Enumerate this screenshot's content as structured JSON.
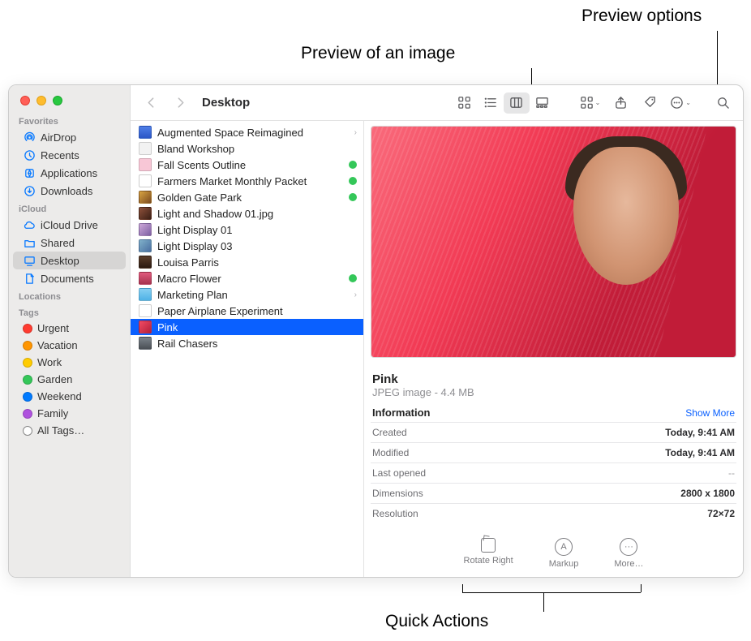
{
  "callouts": {
    "preview_image": "Preview of an image",
    "preview_options": "Preview options",
    "quick_actions": "Quick Actions"
  },
  "toolbar": {
    "title": "Desktop"
  },
  "sidebar": {
    "sections": {
      "favorites": "Favorites",
      "icloud": "iCloud",
      "locations": "Locations",
      "tags": "Tags"
    },
    "favorites": [
      {
        "label": "AirDrop"
      },
      {
        "label": "Recents"
      },
      {
        "label": "Applications"
      },
      {
        "label": "Downloads"
      }
    ],
    "icloud": [
      {
        "label": "iCloud Drive"
      },
      {
        "label": "Shared"
      },
      {
        "label": "Desktop",
        "selected": true
      },
      {
        "label": "Documents"
      }
    ],
    "tags": [
      {
        "label": "Urgent",
        "color": "#ff3b30"
      },
      {
        "label": "Vacation",
        "color": "#ff9500"
      },
      {
        "label": "Work",
        "color": "#ffcc00"
      },
      {
        "label": "Garden",
        "color": "#34c759"
      },
      {
        "label": "Weekend",
        "color": "#007aff"
      },
      {
        "label": "Family",
        "color": "#af52de"
      },
      {
        "label": "All Tags…"
      }
    ]
  },
  "files": [
    {
      "name": "Augmented Space Reimagined",
      "icon": "fi-blue",
      "chev": true
    },
    {
      "name": "Bland Workshop",
      "icon": "fi-paper"
    },
    {
      "name": "Fall Scents Outline",
      "icon": "fi-pink",
      "tag": true
    },
    {
      "name": "Farmers Market Monthly Packet",
      "icon": "fi-page",
      "tag": true
    },
    {
      "name": "Golden Gate Park",
      "icon": "fi-img1",
      "tag": true
    },
    {
      "name": "Light and Shadow 01.jpg",
      "icon": "fi-img2"
    },
    {
      "name": "Light Display 01",
      "icon": "fi-img3"
    },
    {
      "name": "Light Display 03",
      "icon": "fi-img4"
    },
    {
      "name": "Louisa Parris",
      "icon": "fi-port"
    },
    {
      "name": "Macro Flower",
      "icon": "fi-flower",
      "tag": true
    },
    {
      "name": "Marketing Plan",
      "icon": "fi-folder",
      "chev": true
    },
    {
      "name": "Paper Airplane Experiment",
      "icon": "fi-page"
    },
    {
      "name": "Pink",
      "icon": "fi-pinkimg",
      "selected": true
    },
    {
      "name": "Rail Chasers",
      "icon": "fi-rail"
    }
  ],
  "preview": {
    "title": "Pink",
    "subtitle": "JPEG image - 4.4 MB",
    "info_header": "Information",
    "show_more": "Show More",
    "rows": [
      {
        "k": "Created",
        "v": "Today, 9:41 AM"
      },
      {
        "k": "Modified",
        "v": "Today, 9:41 AM"
      },
      {
        "k": "Last opened",
        "v": "--",
        "dim": true
      },
      {
        "k": "Dimensions",
        "v": "2800 x 1800"
      },
      {
        "k": "Resolution",
        "v": "72×72"
      }
    ],
    "actions": {
      "rotate": "Rotate Right",
      "markup": "Markup",
      "more": "More…"
    }
  }
}
